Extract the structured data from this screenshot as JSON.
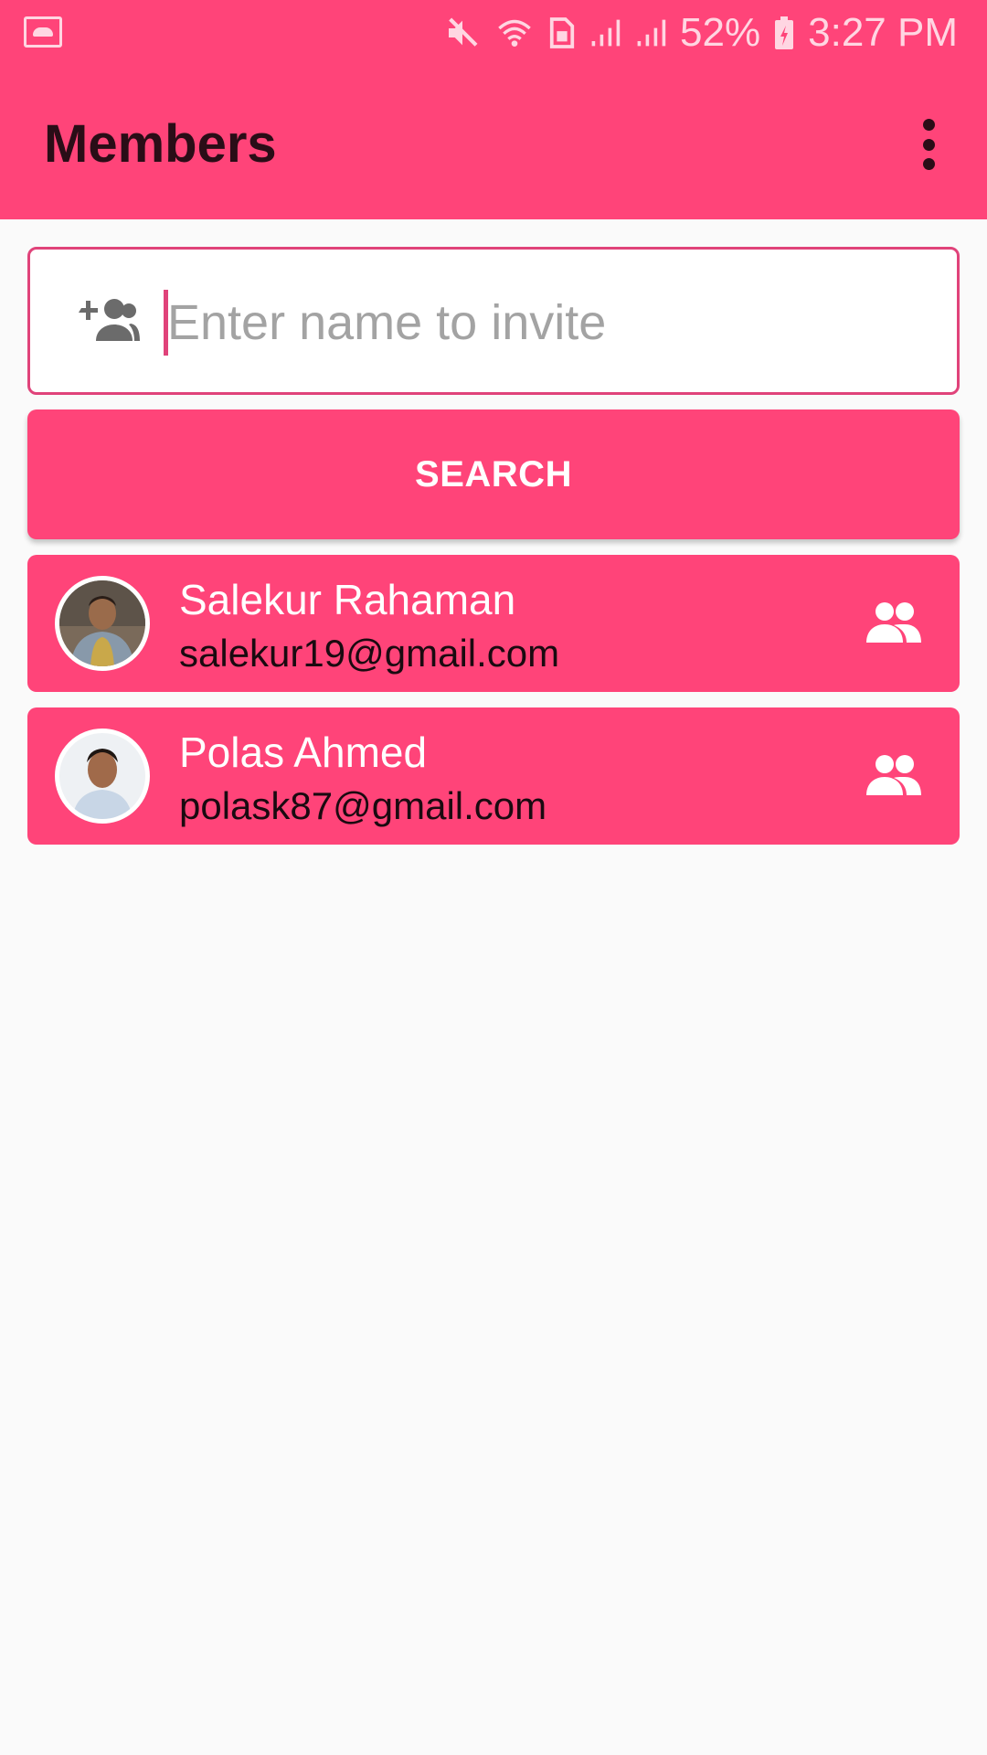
{
  "status_bar": {
    "battery": "52%",
    "time": "3:27 PM",
    "icons": [
      "gallery-icon",
      "mute-icon",
      "wifi-icon",
      "sim-icon",
      "signal-icon",
      "signal-icon",
      "battery-charging-icon"
    ]
  },
  "app_bar": {
    "title": "Members",
    "menu_icon": "more-vert-icon"
  },
  "invite": {
    "icon": "group-add-icon",
    "placeholder": "Enter name to invite",
    "value": ""
  },
  "search_button": {
    "label": "SEARCH"
  },
  "members": [
    {
      "name": "Salekur Rahaman",
      "email": "salekur19@gmail.com",
      "icon": "group-icon"
    },
    {
      "name": "Polas Ahmed",
      "email": "polask87@gmail.com",
      "icon": "group-icon"
    }
  ],
  "colors": {
    "primary": "#ff4479",
    "accent": "#e0437a",
    "background": "#fafafa",
    "title_text": "#2a0d17"
  }
}
